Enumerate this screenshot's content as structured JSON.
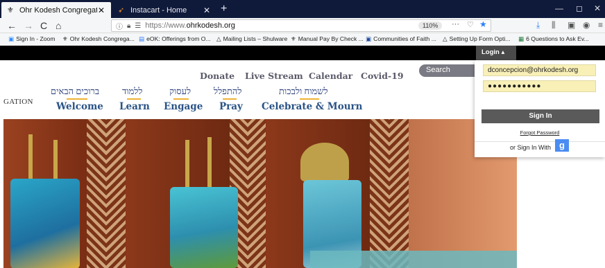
{
  "browser": {
    "tabs": [
      {
        "title": "Ohr Kodesh Congregation",
        "favicon": "ohr-kodesh-logo",
        "close": "✕"
      },
      {
        "title": "Instacart - Home",
        "favicon": "instacart-carrot",
        "close": "✕"
      }
    ],
    "new_tab": "+",
    "window_controls": {
      "minimize": "—",
      "maximize": "◻",
      "close": "✕"
    },
    "nav": {
      "back": "←",
      "forward": "→",
      "reload": "C",
      "home": "⌂"
    },
    "url": {
      "scheme": "https://www.",
      "host": "ohrkodesh.org",
      "zoom": "110%",
      "more": "···"
    },
    "bookmarks": [
      "Sign In - Zoom",
      "Ohr Kodesh Congrega...",
      "eOK: Offerings from O...",
      "Mailing Lists – Shulware",
      "Manual Pay By Check ...",
      "Communities of Faith ...",
      "Setting Up Form Opti...",
      "6 Questions to Ask Ev..."
    ]
  },
  "site": {
    "top_nav": [
      "Donate",
      "Live Stream",
      "Calendar",
      "Covid-19"
    ],
    "search_placeholder": "Search",
    "org_name_fragment": "GATION",
    "menu": [
      {
        "hebrew": "ברוכים הבאים",
        "english": "Welcome"
      },
      {
        "hebrew": "ללמוד",
        "english": "Learn"
      },
      {
        "hebrew": "לעסוק",
        "english": "Engage"
      },
      {
        "hebrew": "להתפלל",
        "english": "Pray"
      },
      {
        "hebrew": "לשמוח ולבכות",
        "english": "Celebrate & Mourn"
      }
    ],
    "accent_color": "#f0b232",
    "link_color": "#2a5386"
  },
  "login": {
    "tab_label": "Login ▴",
    "email_value": "dconcepcion@ohrkodesh.org",
    "password_value": "●●●●●●●●●●●",
    "signin_label": "Sign In",
    "forgot_label": "Forgot Password",
    "or_sign_in_with": "or Sign In With",
    "google_label": "g"
  }
}
